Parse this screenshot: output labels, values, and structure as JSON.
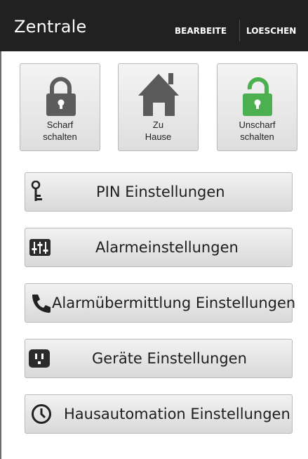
{
  "header": {
    "title": "Zentrale",
    "edit_label": "BEARBEITE",
    "delete_label": "LOESCHEN"
  },
  "modes": [
    {
      "label": "Scharf\nschalten",
      "icon": "locked-padlock-icon",
      "color": "#5a5a5a"
    },
    {
      "label": "Zu\nHause",
      "icon": "house-icon",
      "color": "#5a5a5a"
    },
    {
      "label": "Unscharf\nschalten",
      "icon": "unlocked-padlock-icon",
      "color": "#4caf50"
    }
  ],
  "menu": [
    {
      "label": "PIN Einstellungen",
      "icon": "key-icon"
    },
    {
      "label": "Alarmeinstellungen",
      "icon": "sliders-icon"
    },
    {
      "label": "Alarmübermittlung Einstellungen",
      "icon": "phone-icon"
    },
    {
      "label": "Geräte Einstellungen",
      "icon": "power-outlet-icon"
    },
    {
      "label": "Hausautomation Einstellungen",
      "icon": "clock-icon"
    }
  ]
}
